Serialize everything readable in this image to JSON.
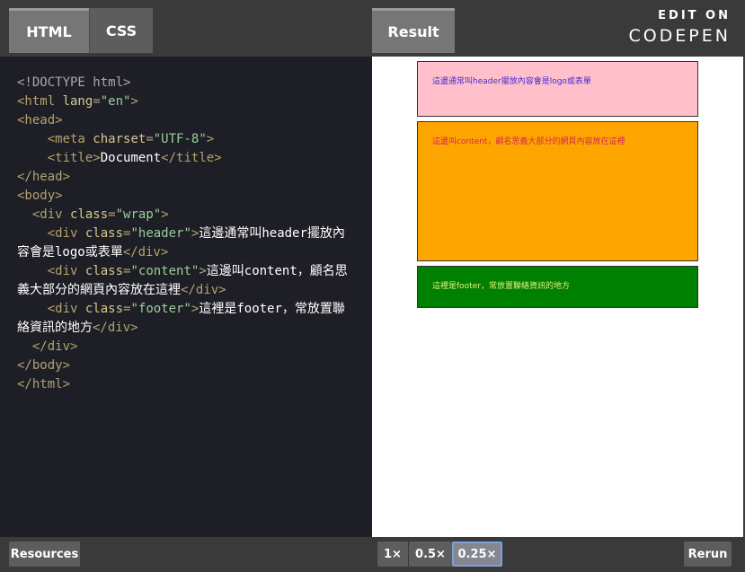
{
  "tabs": {
    "html": "HTML",
    "css": "CSS",
    "result": "Result"
  },
  "branding": {
    "edit_on": "EDIT ON",
    "codepen": "CODEPEN"
  },
  "code_lines": [
    [
      {
        "t": "doctype",
        "v": "<!DOCTYPE html>"
      }
    ],
    [
      {
        "t": "tag",
        "v": "<html "
      },
      {
        "t": "attr",
        "v": "lang"
      },
      {
        "t": "tag",
        "v": "="
      },
      {
        "t": "str",
        "v": "\"en\""
      },
      {
        "t": "tag",
        "v": ">"
      }
    ],
    [
      {
        "t": "tag",
        "v": "<head>"
      }
    ],
    [
      {
        "t": "txt",
        "v": "    "
      },
      {
        "t": "tag",
        "v": "<meta "
      },
      {
        "t": "attr",
        "v": "charset"
      },
      {
        "t": "tag",
        "v": "="
      },
      {
        "t": "str",
        "v": "\"UTF-8\""
      },
      {
        "t": "tag",
        "v": ">"
      }
    ],
    [
      {
        "t": "txt",
        "v": "    "
      },
      {
        "t": "tag",
        "v": "<title>"
      },
      {
        "t": "txt",
        "v": "Document"
      },
      {
        "t": "tag",
        "v": "</title>"
      }
    ],
    [
      {
        "t": "tag",
        "v": "</head>"
      }
    ],
    [
      {
        "t": "tag",
        "v": "<body>"
      }
    ],
    [
      {
        "t": "txt",
        "v": "  "
      },
      {
        "t": "tag",
        "v": "<div "
      },
      {
        "t": "attr",
        "v": "class"
      },
      {
        "t": "tag",
        "v": "="
      },
      {
        "t": "str",
        "v": "\"wrap\""
      },
      {
        "t": "tag",
        "v": ">"
      }
    ],
    [
      {
        "t": "txt",
        "v": "    "
      },
      {
        "t": "tag",
        "v": "<div "
      },
      {
        "t": "attr",
        "v": "class"
      },
      {
        "t": "tag",
        "v": "="
      },
      {
        "t": "str",
        "v": "\"header\""
      },
      {
        "t": "tag",
        "v": ">"
      },
      {
        "t": "txt",
        "v": "這邊通常叫header擺放內容會是logo或表單"
      },
      {
        "t": "tag",
        "v": "</div>"
      }
    ],
    [
      {
        "t": "txt",
        "v": "    "
      },
      {
        "t": "tag",
        "v": "<div "
      },
      {
        "t": "attr",
        "v": "class"
      },
      {
        "t": "tag",
        "v": "="
      },
      {
        "t": "str",
        "v": "\"content\""
      },
      {
        "t": "tag",
        "v": ">"
      },
      {
        "t": "txt",
        "v": "這邊叫content，顧名思義大部分的網頁內容放在這裡"
      },
      {
        "t": "tag",
        "v": "</div>"
      }
    ],
    [
      {
        "t": "txt",
        "v": "    "
      },
      {
        "t": "tag",
        "v": "<div "
      },
      {
        "t": "attr",
        "v": "class"
      },
      {
        "t": "tag",
        "v": "="
      },
      {
        "t": "str",
        "v": "\"footer\""
      },
      {
        "t": "tag",
        "v": ">"
      },
      {
        "t": "txt",
        "v": "這裡是footer，常放置聯絡資訊的地方"
      },
      {
        "t": "tag",
        "v": "</div>"
      }
    ],
    [
      {
        "t": "txt",
        "v": "  "
      },
      {
        "t": "tag",
        "v": "</div>"
      }
    ],
    [
      {
        "t": "tag",
        "v": "</body>"
      }
    ],
    [
      {
        "t": "tag",
        "v": "</html>"
      }
    ]
  ],
  "result": {
    "header_text": "這邊通常叫header擺放內容會是logo或表單",
    "content_text": "這邊叫content，顧名思義大部分的網頁內容放在這裡",
    "footer_text": "這裡是footer，常放置聯絡資訊的地方"
  },
  "bottom": {
    "resources": "Resources",
    "zoom_1x": "1×",
    "zoom_05x": "0.5×",
    "zoom_025x": "0.25×",
    "rerun": "Rerun"
  },
  "colors": {
    "header_bg": "pink",
    "content_bg": "orange",
    "footer_bg": "green"
  }
}
